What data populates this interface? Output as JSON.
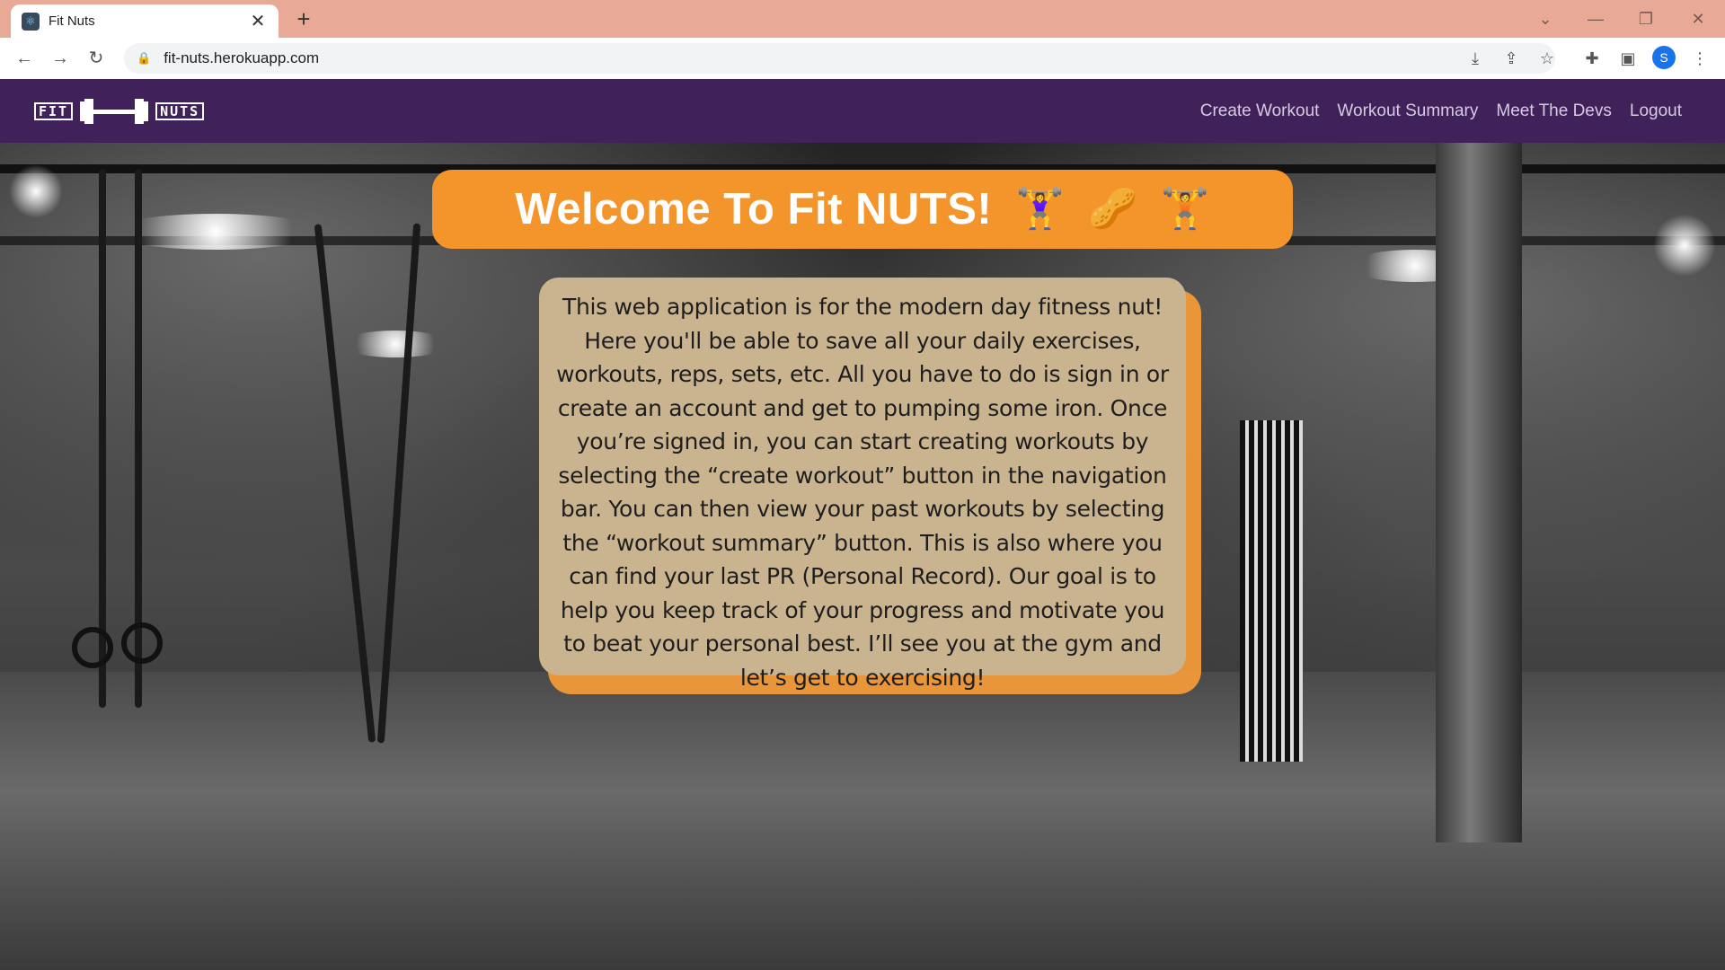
{
  "browser": {
    "tab_title": "Fit Nuts",
    "tab_close": "✕",
    "new_tab": "+",
    "url": "fit-nuts.herokuapp.com",
    "profile_initial": "S",
    "icons": [
      "back-icon",
      "forward-icon",
      "reload-icon",
      "lock-icon",
      "install-icon",
      "share-icon",
      "star-icon",
      "extensions-icon",
      "side-panel-icon",
      "menu-icon"
    ]
  },
  "site": {
    "logo_left": "FIT",
    "logo_right": "NUTS",
    "nav": {
      "create_workout": "Create Workout",
      "workout_summary": "Workout Summary",
      "meet_the_devs": "Meet The Devs",
      "logout": "Logout"
    }
  },
  "hero": {
    "title": "Welcome To Fit NUTS!",
    "emoji": [
      "🏋️‍♀️",
      "🥜",
      "🏋️"
    ],
    "description": "This web application is for the modern day fitness nut! Here you'll be able to save all your daily exercises, workouts, reps, sets, etc. All you have to do is sign in or create an account and get to pumping some iron. Once you’re signed in, you can start creating workouts by selecting the “create workout” button in the navigation bar. You can then view your past workouts by selecting the “workout summary” button. This is also where you can find your last PR (Personal Record). Our goal is to help you keep track of your progress and motivate you to beat your personal best. I’ll see you at the gym and let’s get to exercising!"
  },
  "colors": {
    "navbar": "#40215a",
    "accent_orange": "#f4952c",
    "card_tan": "#c9b48f",
    "tabstrip": "#e8a996"
  }
}
